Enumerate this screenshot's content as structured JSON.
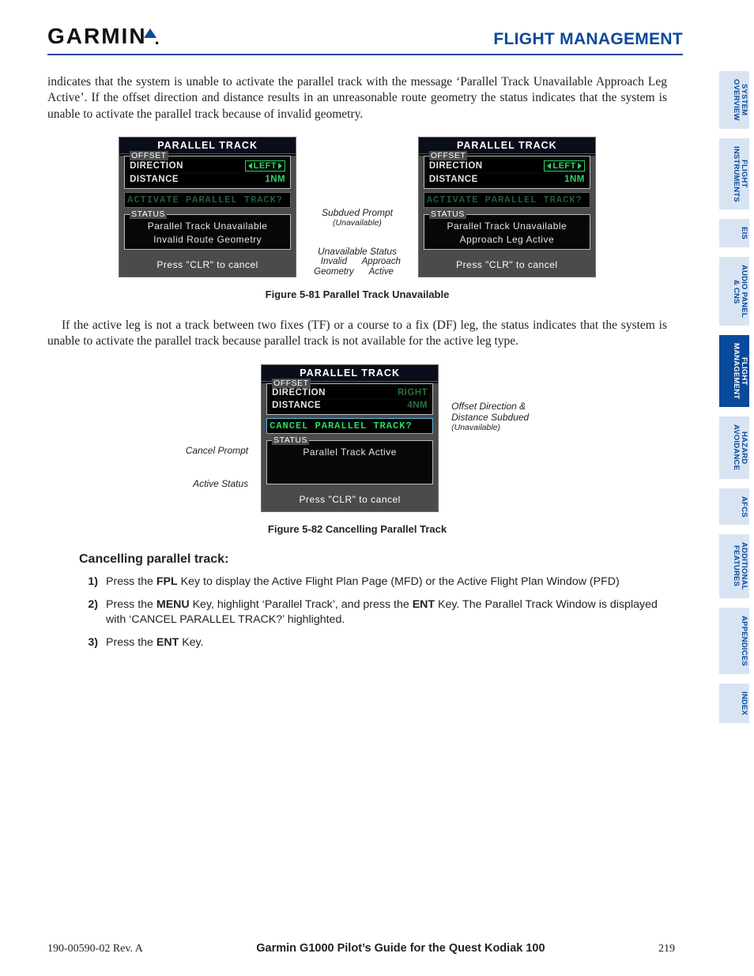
{
  "header": {
    "logo_text": "GARMIN",
    "section": "FLIGHT MANAGEMENT"
  },
  "para1": "indicates that the system is unable to activate the parallel track with the message ‘Parallel Track Unavailable Approach Leg Active’.  If the offset direction and distance results in an unreasonable route geometry the status indicates that the system is unable to activate the parallel track because of invalid geometry.",
  "fig81": {
    "left_window": {
      "title": "PARALLEL TRACK",
      "group_offset_label": "OFFSET",
      "rows": {
        "direction_label": "DIRECTION",
        "direction_value": "LEFT",
        "distance_label": "DISTANCE",
        "distance_value": "1NM"
      },
      "prompt": "ACTIVATE PARALLEL TRACK?",
      "group_status_label": "STATUS",
      "status_line1": "Parallel Track Unavailable",
      "status_line2": "Invalid Route Geometry",
      "footer": "Press \"CLR\" to cancel"
    },
    "middle_annotations": {
      "a1_line1": "Subdued Prompt",
      "a1_line2": "(Unavailable)",
      "a2_line1": "Unavailable Status",
      "a2_left1": "Invalid",
      "a2_left2": "Geometry",
      "a2_right1": "Approach",
      "a2_right2": "Active"
    },
    "right_window": {
      "title": "PARALLEL TRACK",
      "group_offset_label": "OFFSET",
      "rows": {
        "direction_label": "DIRECTION",
        "direction_value": "LEFT",
        "distance_label": "DISTANCE",
        "distance_value": "1NM"
      },
      "prompt": "ACTIVATE PARALLEL TRACK?",
      "group_status_label": "STATUS",
      "status_line1": "Parallel Track Unavailable",
      "status_line2": "Approach Leg Active",
      "footer": "Press \"CLR\" to cancel"
    },
    "caption": "Figure 5-81  Parallel Track Unavailable"
  },
  "para2": "If the active leg is not a track between two fixes (TF) or a course to a fix (DF) leg, the status indicates that the system is unable to activate the parallel track because parallel track is not available for the active leg type.",
  "fig82": {
    "left_annotations": {
      "l1": "Cancel Prompt",
      "l2": "Active Status"
    },
    "window": {
      "title": "PARALLEL TRACK",
      "group_offset_label": "OFFSET",
      "rows": {
        "direction_label": "DIRECTION",
        "direction_value": "RIGHT",
        "distance_label": "DISTANCE",
        "distance_value": "4NM"
      },
      "prompt": "CANCEL PARALLEL TRACK?",
      "group_status_label": "STATUS",
      "status_line1": "Parallel Track Active",
      "footer": "Press \"CLR\" to cancel"
    },
    "right_annotations": {
      "r1_line1": "Offset Direction &",
      "r1_line2": "Distance Subdued",
      "r1_line3": "(Unavailable)"
    },
    "caption": "Figure 5-82  Cancelling Parallel Track"
  },
  "procedure": {
    "title": "Cancelling parallel track:",
    "steps": [
      {
        "num": "1)",
        "text_pre": "Press the ",
        "key1": "FPL",
        "text_mid": " Key to display the Active Flight Plan Page (MFD) or the Active Flight Plan Window (PFD)"
      },
      {
        "num": "2)",
        "text_pre": "Press the ",
        "key1": "MENU",
        "text_mid": " Key, highlight ‘Parallel Track’, and press the ",
        "key2": "ENT",
        "text_post": " Key.  The Parallel Track Window is displayed with ‘CANCEL PARALLEL TRACK?’ highlighted."
      },
      {
        "num": "3)",
        "text_pre": "Press the ",
        "key1": "ENT",
        "text_mid": " Key."
      }
    ]
  },
  "footer": {
    "docnum": "190-00590-02  Rev. A",
    "guide": "Garmin G1000 Pilot’s Guide for the Quest Kodiak 100",
    "page": "219"
  },
  "tabs": [
    {
      "line1": "SYSTEM",
      "line2": "OVERVIEW",
      "active": false
    },
    {
      "line1": "FLIGHT",
      "line2": "INSTRUMENTS",
      "active": false
    },
    {
      "line1": "EIS",
      "line2": "",
      "active": false
    },
    {
      "line1": "AUDIO PANEL",
      "line2": "& CNS",
      "active": false
    },
    {
      "line1": "FLIGHT",
      "line2": "MANAGEMENT",
      "active": true
    },
    {
      "line1": "HAZARD",
      "line2": "AVOIDANCE",
      "active": false
    },
    {
      "line1": "AFCS",
      "line2": "",
      "active": false
    },
    {
      "line1": "ADDITIONAL",
      "line2": "FEATURES",
      "active": false
    },
    {
      "line1": "APPENDICES",
      "line2": "",
      "active": false
    },
    {
      "line1": "INDEX",
      "line2": "",
      "active": false
    }
  ]
}
